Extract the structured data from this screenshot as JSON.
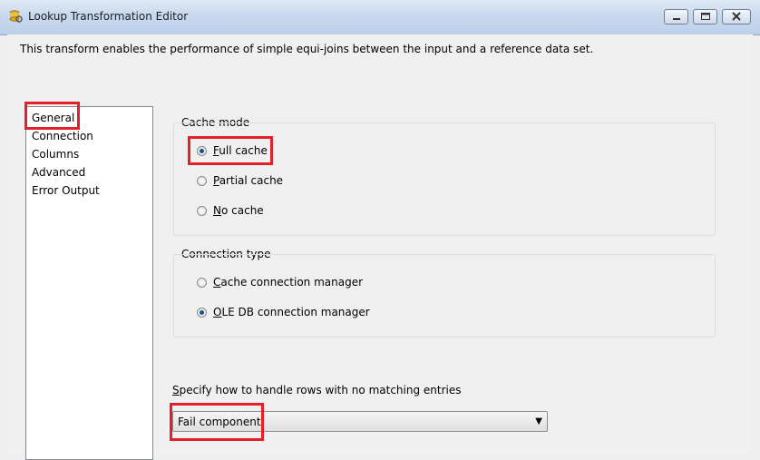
{
  "window": {
    "title": "Lookup Transformation Editor"
  },
  "description": "This transform enables the performance of simple equi-joins between the input and a reference data set.",
  "nav": {
    "items": [
      "General",
      "Connection",
      "Columns",
      "Advanced",
      "Error Output"
    ],
    "selected": "General"
  },
  "cache_mode": {
    "label": "Cache mode",
    "options": [
      {
        "mnemonic": "F",
        "rest": "ull cache",
        "checked": true
      },
      {
        "mnemonic": "P",
        "rest": "artial cache",
        "checked": false
      },
      {
        "mnemonic": "N",
        "rest": "o cache",
        "checked": false
      }
    ]
  },
  "connection_type": {
    "label": "Connection type",
    "options": [
      {
        "mnemonic": "C",
        "rest": "ache connection manager",
        "checked": false
      },
      {
        "mnemonic": "O",
        "rest": "LE DB connection manager",
        "checked": true
      }
    ]
  },
  "no_match": {
    "mnemonic": "S",
    "label_rest": "pecify how to handle rows with no matching entries",
    "value": "Fail component"
  },
  "colors": {
    "highlight": "#e3202a",
    "title_bar": "#c9d9ee"
  }
}
